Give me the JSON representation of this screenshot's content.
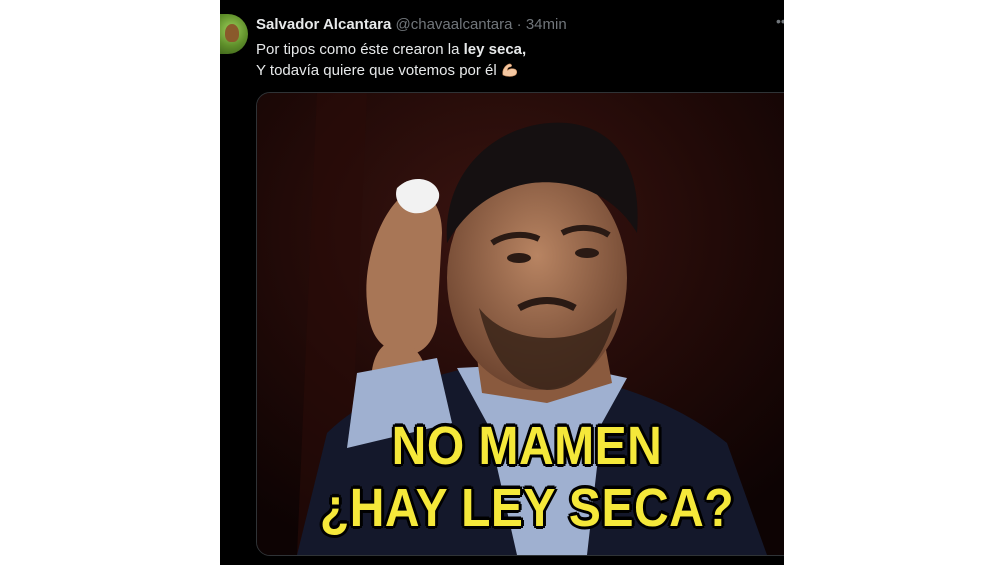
{
  "tweet": {
    "author_name": "Salvador Alcantara",
    "handle": "@chavaalcantara",
    "separator": "·",
    "time": "34min",
    "more_icon": "more-icon",
    "text_line1_prefix": "Por tipos como éste crearon la ",
    "text_line1_bold": "ley seca,",
    "text_line2": "Y todavía quiere que votemos por él",
    "emoji": "flexed-biceps-emoji"
  },
  "meme": {
    "caption_line1": "NO MAMEN",
    "caption_line2": "¿HAY LEY SECA?",
    "caption_color": "#f5e83a"
  },
  "colors": {
    "background": "#000000",
    "primary_text": "#e7e9ea",
    "secondary_text": "#71767b",
    "border": "#2f3336"
  }
}
